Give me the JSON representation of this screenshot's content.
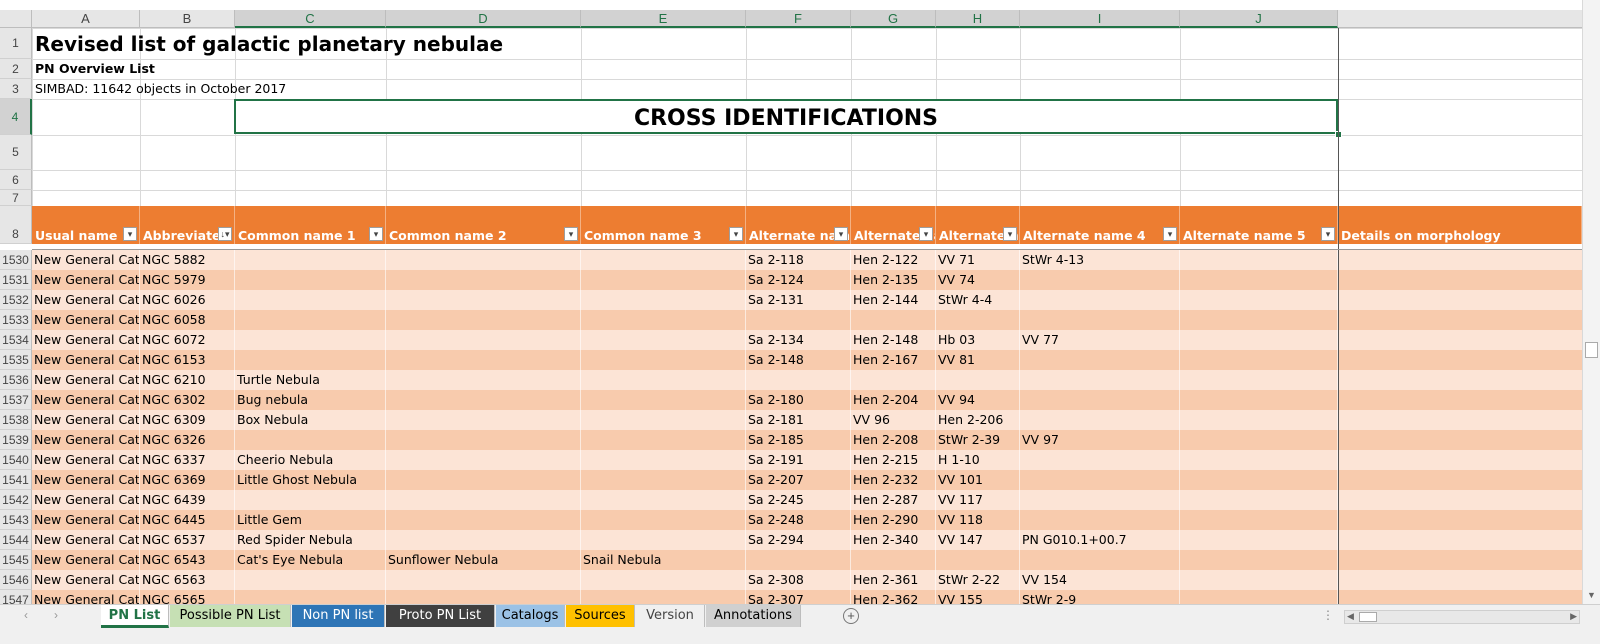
{
  "columns": [
    "A",
    "B",
    "C",
    "D",
    "E",
    "F",
    "G",
    "H",
    "I",
    "J"
  ],
  "top_rows": [
    "1",
    "2",
    "3",
    "4",
    "5",
    "6",
    "7",
    "8"
  ],
  "title": "Revised list of galactic planetary nebulae",
  "subtitle": "PN Overview List",
  "simbad_note": "SIMBAD: 11642 objects in October 2017",
  "section_heading": "CROSS IDENTIFICATIONS",
  "headers": [
    "Usual name",
    "Abbreviated",
    "Common name 1",
    "Common name 2",
    "Common name 3",
    "Alternate name",
    "Alternate name",
    "Alternate name",
    "Alternate name 4",
    "Alternate name 5",
    "Details on morphology"
  ],
  "rows": [
    {
      "n": "1530",
      "cells": [
        "New General Catalogue",
        "NGC 5882",
        "",
        "",
        "",
        "Sa 2-118",
        "Hen 2-122",
        "VV 71",
        "StWr 4-13",
        ""
      ]
    },
    {
      "n": "1531",
      "cells": [
        "New General Catalogue",
        "NGC 5979",
        "",
        "",
        "",
        "Sa 2-124",
        "Hen 2-135",
        "VV 74",
        "",
        ""
      ]
    },
    {
      "n": "1532",
      "cells": [
        "New General Catalogue",
        "NGC 6026",
        "",
        "",
        "",
        "Sa 2-131",
        "Hen 2-144",
        "StWr 4-4",
        "",
        ""
      ]
    },
    {
      "n": "1533",
      "cells": [
        "New General Catalogue",
        "NGC 6058",
        "",
        "",
        "",
        "",
        "",
        "",
        "",
        ""
      ]
    },
    {
      "n": "1534",
      "cells": [
        "New General Catalogue",
        "NGC 6072",
        "",
        "",
        "",
        "Sa 2-134",
        "Hen 2-148",
        "Hb 03",
        "VV 77",
        ""
      ]
    },
    {
      "n": "1535",
      "cells": [
        "New General Catalogue",
        "NGC 6153",
        "",
        "",
        "",
        "Sa 2-148",
        "Hen 2-167",
        "VV 81",
        "",
        ""
      ]
    },
    {
      "n": "1536",
      "cells": [
        "New General Catalogue",
        "NGC 6210",
        "Turtle Nebula",
        "",
        "",
        "",
        "",
        "",
        "",
        ""
      ]
    },
    {
      "n": "1537",
      "cells": [
        "New General Catalogue",
        "NGC 6302",
        "Bug nebula",
        "",
        "",
        "Sa 2-180",
        "Hen 2-204",
        "VV 94",
        "",
        ""
      ]
    },
    {
      "n": "1538",
      "cells": [
        "New General Catalogue",
        "NGC 6309",
        "Box Nebula",
        "",
        "",
        "Sa 2-181",
        "VV 96",
        "Hen 2-206",
        "",
        ""
      ]
    },
    {
      "n": "1539",
      "cells": [
        "New General Catalogue",
        "NGC 6326",
        "",
        "",
        "",
        "Sa 2-185",
        "Hen 2-208",
        "StWr 2-39",
        "VV 97",
        ""
      ]
    },
    {
      "n": "1540",
      "cells": [
        "New General Catalogue",
        "NGC 6337",
        "Cheerio Nebula",
        "",
        "",
        "Sa 2-191",
        "Hen 2-215",
        "H 1-10",
        "",
        ""
      ]
    },
    {
      "n": "1541",
      "cells": [
        "New General Catalogue",
        "NGC 6369",
        "Little Ghost Nebula",
        "",
        "",
        "Sa 2-207",
        "Hen 2-232",
        "VV 101",
        "",
        ""
      ]
    },
    {
      "n": "1542",
      "cells": [
        "New General Catalogue",
        "NGC 6439",
        "",
        "",
        "",
        "Sa 2-245",
        "Hen 2-287",
        "VV 117",
        "",
        ""
      ]
    },
    {
      "n": "1543",
      "cells": [
        "New General Catalogue",
        "NGC 6445",
        "Little Gem",
        "",
        "",
        "Sa 2-248",
        "Hen 2-290",
        "VV 118",
        "",
        ""
      ]
    },
    {
      "n": "1544",
      "cells": [
        "New General Catalogue",
        "NGC 6537",
        "Red Spider Nebula",
        "",
        "",
        "Sa 2-294",
        "Hen 2-340",
        "VV 147",
        "PN G010.1+00.7",
        ""
      ]
    },
    {
      "n": "1545",
      "cells": [
        "New General Catalogue",
        "NGC 6543",
        "Cat's Eye Nebula",
        "Sunflower Nebula",
        "Snail Nebula",
        "",
        "",
        "",
        "",
        ""
      ]
    },
    {
      "n": "1546",
      "cells": [
        "New General Catalogue",
        "NGC 6563",
        "",
        "",
        "",
        "Sa 2-308",
        "Hen 2-361",
        "StWr 2-22",
        "VV 154",
        ""
      ]
    },
    {
      "n": "1547",
      "cells": [
        "New General Catalogue",
        "NGC 6565",
        "",
        "",
        "",
        "Sa 2-307",
        "Hen 2-362",
        "VV 155",
        "StWr 2-9",
        ""
      ]
    }
  ],
  "tabs": [
    {
      "label": "PN List",
      "bg": "#ffffff",
      "color": "#217346",
      "active": true
    },
    {
      "label": "Possible PN List",
      "bg": "#c6e0b4",
      "color": "#000000"
    },
    {
      "label": "Non PN list",
      "bg": "#2e75b6",
      "color": "#ffffff"
    },
    {
      "label": "Proto PN List",
      "bg": "#404040",
      "color": "#ffffff"
    },
    {
      "label": "Catalogs",
      "bg": "#9bc2e6",
      "color": "#000000"
    },
    {
      "label": "Sources",
      "bg": "#ffc000",
      "color": "#000000"
    },
    {
      "label": "Version",
      "bg": "#f0f0f0",
      "color": "#444444"
    },
    {
      "label": "Annotations",
      "bg": "#d0d0d0",
      "color": "#000000"
    }
  ],
  "colors": {
    "header_orange": "#ed7d31",
    "band_light": "#fce4d6",
    "band_dark": "#f8cbad",
    "excel_green": "#217346"
  }
}
